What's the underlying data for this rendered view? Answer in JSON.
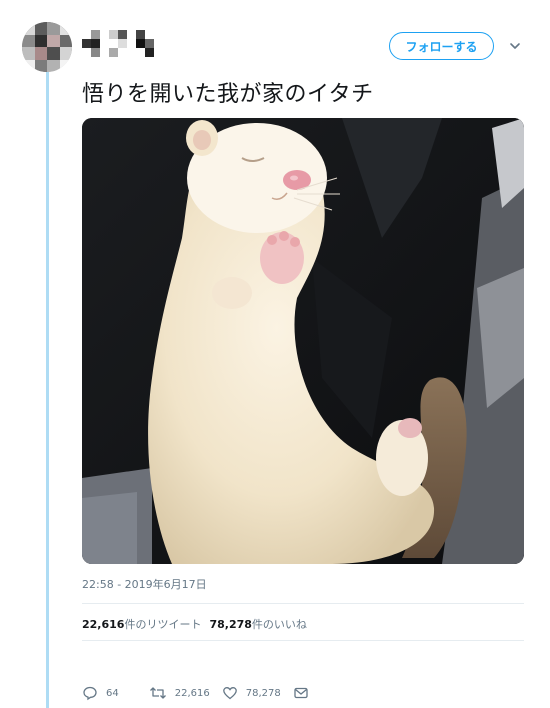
{
  "header": {
    "follow_label": "フォローする"
  },
  "tweet": {
    "text": "悟りを開いた我が家のイタチ",
    "timestamp": "22:58 - 2019年6月17日"
  },
  "stats": {
    "retweets_count": "22,616",
    "retweets_label": "件のリツイート",
    "likes_count": "78,278",
    "likes_label": "件のいいね"
  },
  "actions": {
    "replies": "64",
    "retweets": "22,616",
    "likes": "78,278"
  },
  "icons": {
    "reply": "reply-icon",
    "retweet": "retweet-icon",
    "like": "heart-icon",
    "dm": "mail-icon",
    "caret": "chevron-down-icon"
  },
  "colors": {
    "accent": "#1da1f2",
    "thread_line": "#aedcf4",
    "muted_text": "#657786"
  }
}
